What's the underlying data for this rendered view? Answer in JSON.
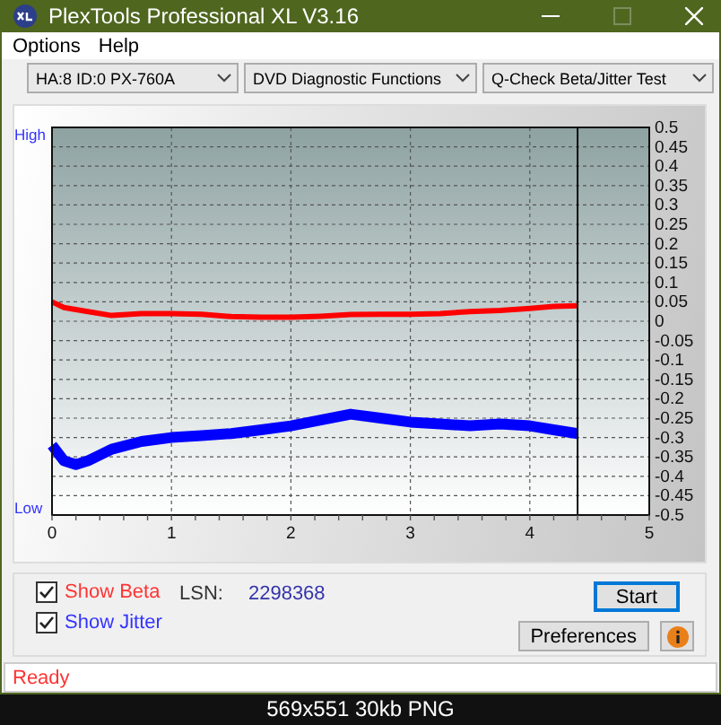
{
  "window": {
    "title": "PlexTools Professional XL V3.16",
    "controls": [
      {
        "kind": "minimize",
        "disabled": false
      },
      {
        "kind": "maximize",
        "disabled": true
      },
      {
        "kind": "close",
        "disabled": false
      }
    ]
  },
  "menu": [
    {
      "label": "Options"
    },
    {
      "label": "Help"
    }
  ],
  "selectors": [
    {
      "value": "HA:8 ID:0  PX-760A"
    },
    {
      "value": "DVD Diagnostic Functions"
    },
    {
      "value": "Q-Check Beta/Jitter Test"
    }
  ],
  "chart": {
    "high_label": "High",
    "low_label": "Low",
    "chart_data": {
      "type": "line",
      "x": [
        0,
        0.1,
        0.2,
        0.3,
        0.5,
        0.75,
        1,
        1.25,
        1.5,
        1.75,
        2,
        2.25,
        2.5,
        2.75,
        3,
        3.25,
        3.5,
        3.75,
        4,
        4.2,
        4.4
      ],
      "series": [
        {
          "color": "#ff0000",
          "values": [
            0.05,
            0.035,
            0.03,
            0.025,
            0.015,
            0.02,
            0.02,
            0.018,
            0.012,
            0.01,
            0.01,
            0.013,
            0.017,
            0.018,
            0.018,
            0.02,
            0.025,
            0.028,
            0.033,
            0.038,
            0.04
          ]
        },
        {
          "color": "#0000ff",
          "values": [
            -0.32,
            -0.36,
            -0.37,
            -0.36,
            -0.33,
            -0.31,
            -0.3,
            -0.295,
            -0.29,
            -0.28,
            -0.27,
            -0.255,
            -0.24,
            -0.25,
            -0.26,
            -0.265,
            -0.27,
            -0.265,
            -0.27,
            -0.28,
            -0.29
          ]
        }
      ],
      "xlim": [
        0,
        5
      ],
      "ylim": [
        -0.5,
        0.5
      ],
      "xticks": [
        0,
        1,
        2,
        3,
        4,
        5
      ],
      "yticks": [
        0.5,
        0.45,
        0.4,
        0.35,
        0.3,
        0.25,
        0.2,
        0.15,
        0.1,
        0.05,
        0,
        -0.05,
        -0.1,
        -0.15,
        -0.2,
        -0.25,
        -0.3,
        -0.35,
        -0.4,
        -0.45,
        -0.5
      ],
      "grid": true,
      "ref_lines": [
        {
          "axis": "x",
          "value": 4.4
        }
      ]
    }
  },
  "options": [
    {
      "label": "Show Beta",
      "checked": true,
      "color": "#ff3333"
    },
    {
      "label": "Show Jitter",
      "checked": true,
      "color": "#3333ff"
    }
  ],
  "lsn": {
    "label": "LSN:",
    "value": "2298368"
  },
  "buttons": [
    {
      "kind": "default",
      "label": "Start"
    },
    {
      "kind": "normal",
      "label": "Preferences"
    },
    {
      "kind": "info"
    }
  ],
  "status": {
    "text": "Ready"
  },
  "caption": {
    "text": "569x551 30kb PNG"
  }
}
